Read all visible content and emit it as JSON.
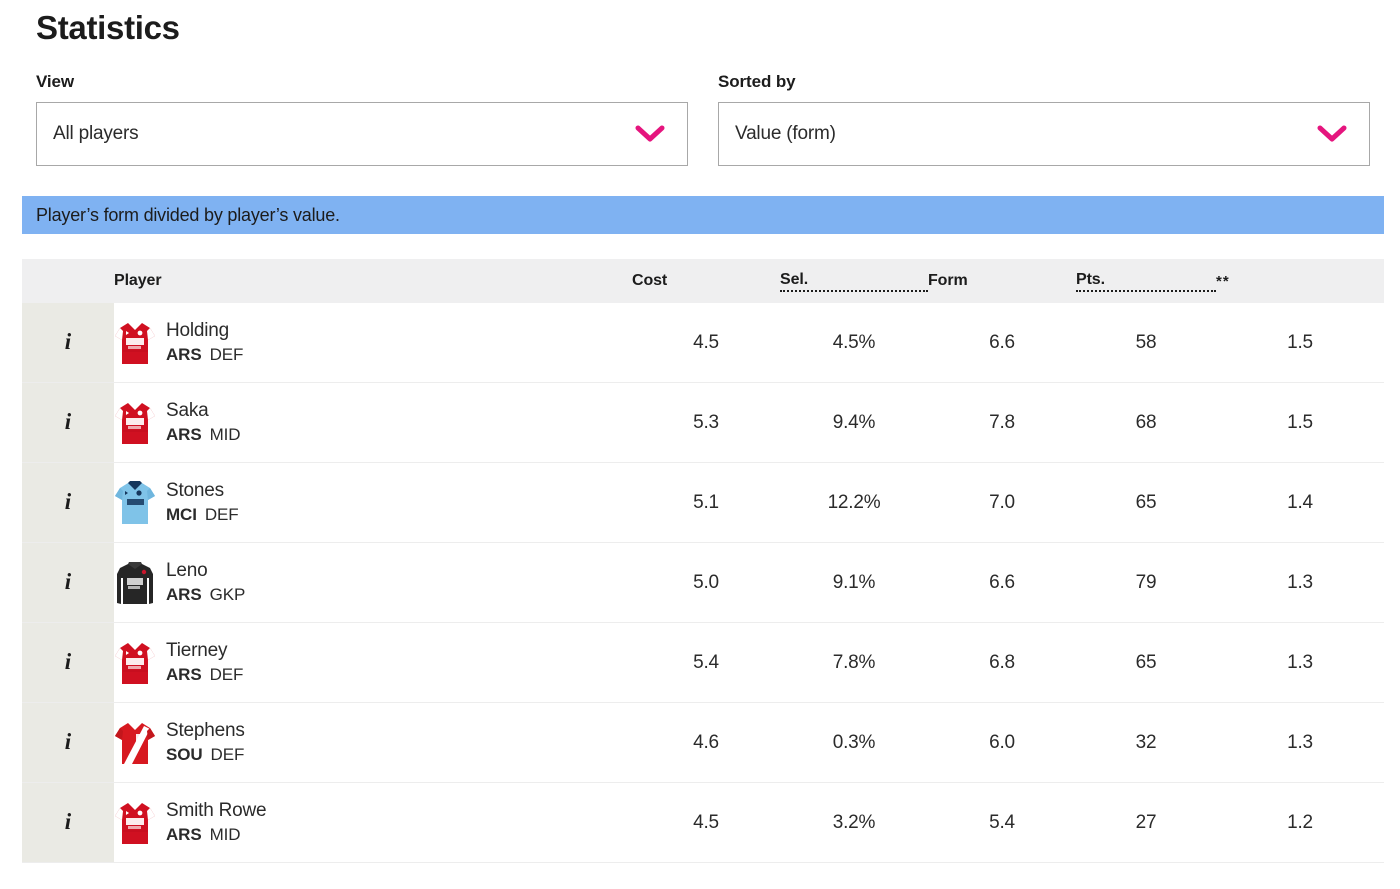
{
  "page": {
    "title": "Statistics"
  },
  "controls": {
    "view": {
      "label": "View",
      "value": "All players",
      "chevron_color": "#e5157e"
    },
    "sorted_by": {
      "label": "Sorted by",
      "value": "Value (form)",
      "chevron_color": "#e5157e"
    }
  },
  "info_banner": {
    "text": "Player’s form divided by player’s value.",
    "background": "#7fb2f2"
  },
  "table": {
    "headers": {
      "info": "",
      "player": "Player",
      "cost": "Cost",
      "sel": "Sel.",
      "form": "Form",
      "pts": "Pts.",
      "star": "**"
    },
    "info_button_glyph": "i",
    "rows": [
      {
        "name": "Holding",
        "team": "ARS",
        "position": "DEF",
        "cost": "4.5",
        "sel": "4.5%",
        "form": "6.6",
        "pts": "58",
        "value": "1.5",
        "kit": "arsenal-home"
      },
      {
        "name": "Saka",
        "team": "ARS",
        "position": "MID",
        "cost": "5.3",
        "sel": "9.4%",
        "form": "7.8",
        "pts": "68",
        "value": "1.5",
        "kit": "arsenal-home"
      },
      {
        "name": "Stones",
        "team": "MCI",
        "position": "DEF",
        "cost": "5.1",
        "sel": "12.2%",
        "form": "7.0",
        "pts": "65",
        "value": "1.4",
        "kit": "mancity-home"
      },
      {
        "name": "Leno",
        "team": "ARS",
        "position": "GKP",
        "cost": "5.0",
        "sel": "9.1%",
        "form": "6.6",
        "pts": "79",
        "value": "1.3",
        "kit": "arsenal-keeper"
      },
      {
        "name": "Tierney",
        "team": "ARS",
        "position": "DEF",
        "cost": "5.4",
        "sel": "7.8%",
        "form": "6.8",
        "pts": "65",
        "value": "1.3",
        "kit": "arsenal-home"
      },
      {
        "name": "Stephens",
        "team": "SOU",
        "position": "DEF",
        "cost": "4.6",
        "sel": "0.3%",
        "form": "6.0",
        "pts": "32",
        "value": "1.3",
        "kit": "southampton-home"
      },
      {
        "name": "Smith Rowe",
        "team": "ARS",
        "position": "MID",
        "cost": "4.5",
        "sel": "3.2%",
        "form": "5.4",
        "pts": "27",
        "value": "1.2",
        "kit": "arsenal-home"
      }
    ]
  }
}
